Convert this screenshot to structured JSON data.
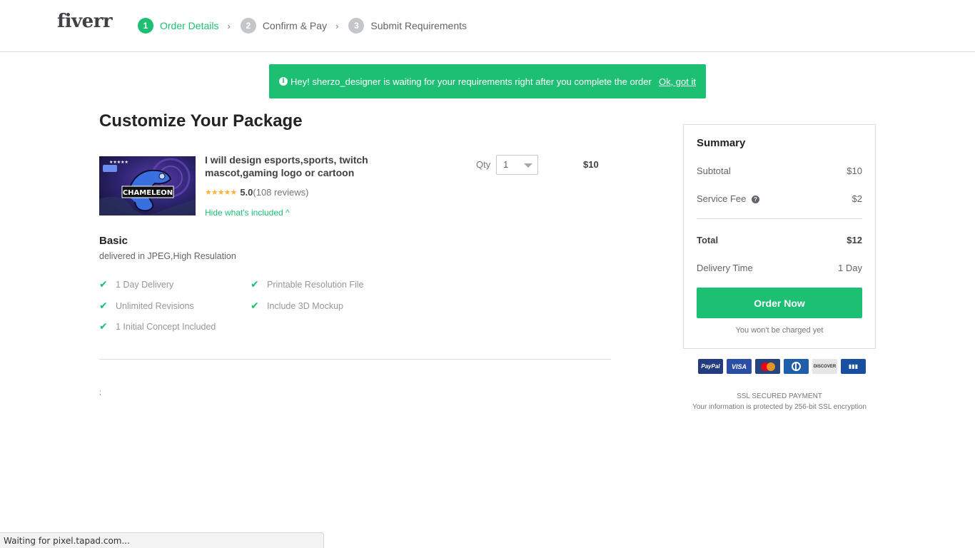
{
  "header": {
    "logo": "fiverr",
    "steps": [
      {
        "num": "1",
        "label": "Order Details",
        "active": true
      },
      {
        "num": "2",
        "label": "Confirm & Pay",
        "active": false
      },
      {
        "num": "3",
        "label": "Submit Requirements",
        "active": false
      }
    ],
    "separator": "›"
  },
  "banner": {
    "icon": "info-icon",
    "message": "Hey! sherzo_designer is waiting for your requirements right after you complete the order",
    "dismiss_label": "Ok, got it"
  },
  "main": {
    "title": "Customize Your Package",
    "gig": {
      "thumbnail_text": "CHAMELEON",
      "title": "I will design esports,sports, twitch mascot,gaming logo or cartoon",
      "stars": "★★★★★",
      "rating": "5.0",
      "reviews": "(108 reviews)",
      "toggle_label": "Hide what's included ^",
      "qty_label": "Qty",
      "qty_value": "1",
      "price": "$10"
    },
    "package": {
      "name": "Basic",
      "description": "delivered in JPEG,High Resulation",
      "features": [
        "1 Day Delivery",
        "Printable Resolution File",
        "Unlimited Revisions",
        "Include 3D Mockup",
        "1 Initial Concept Included"
      ]
    },
    "stray_text": ";"
  },
  "summary": {
    "title": "Summary",
    "subtotal_label": "Subtotal",
    "subtotal_value": "$10",
    "fee_label": "Service Fee",
    "fee_value": "$2",
    "total_label": "Total",
    "total_value": "$12",
    "delivery_label": "Delivery Time",
    "delivery_value": "1 Day",
    "order_button": "Order Now",
    "charge_note": "You won't be charged yet"
  },
  "payments": {
    "methods": [
      "PayPal",
      "VISA",
      "MasterCard",
      "Diners Club",
      "DISCOVER",
      "JCB"
    ]
  },
  "ssl": {
    "title": "SSL SECURED PAYMENT",
    "description": "Your information is protected by 256-bit SSL encryption"
  },
  "statusbar": {
    "text": "Waiting for pixel.tapad.com..."
  },
  "colors": {
    "brand_green": "#1dbf73",
    "star_color": "#ffb33e",
    "text_dark": "#222325"
  }
}
